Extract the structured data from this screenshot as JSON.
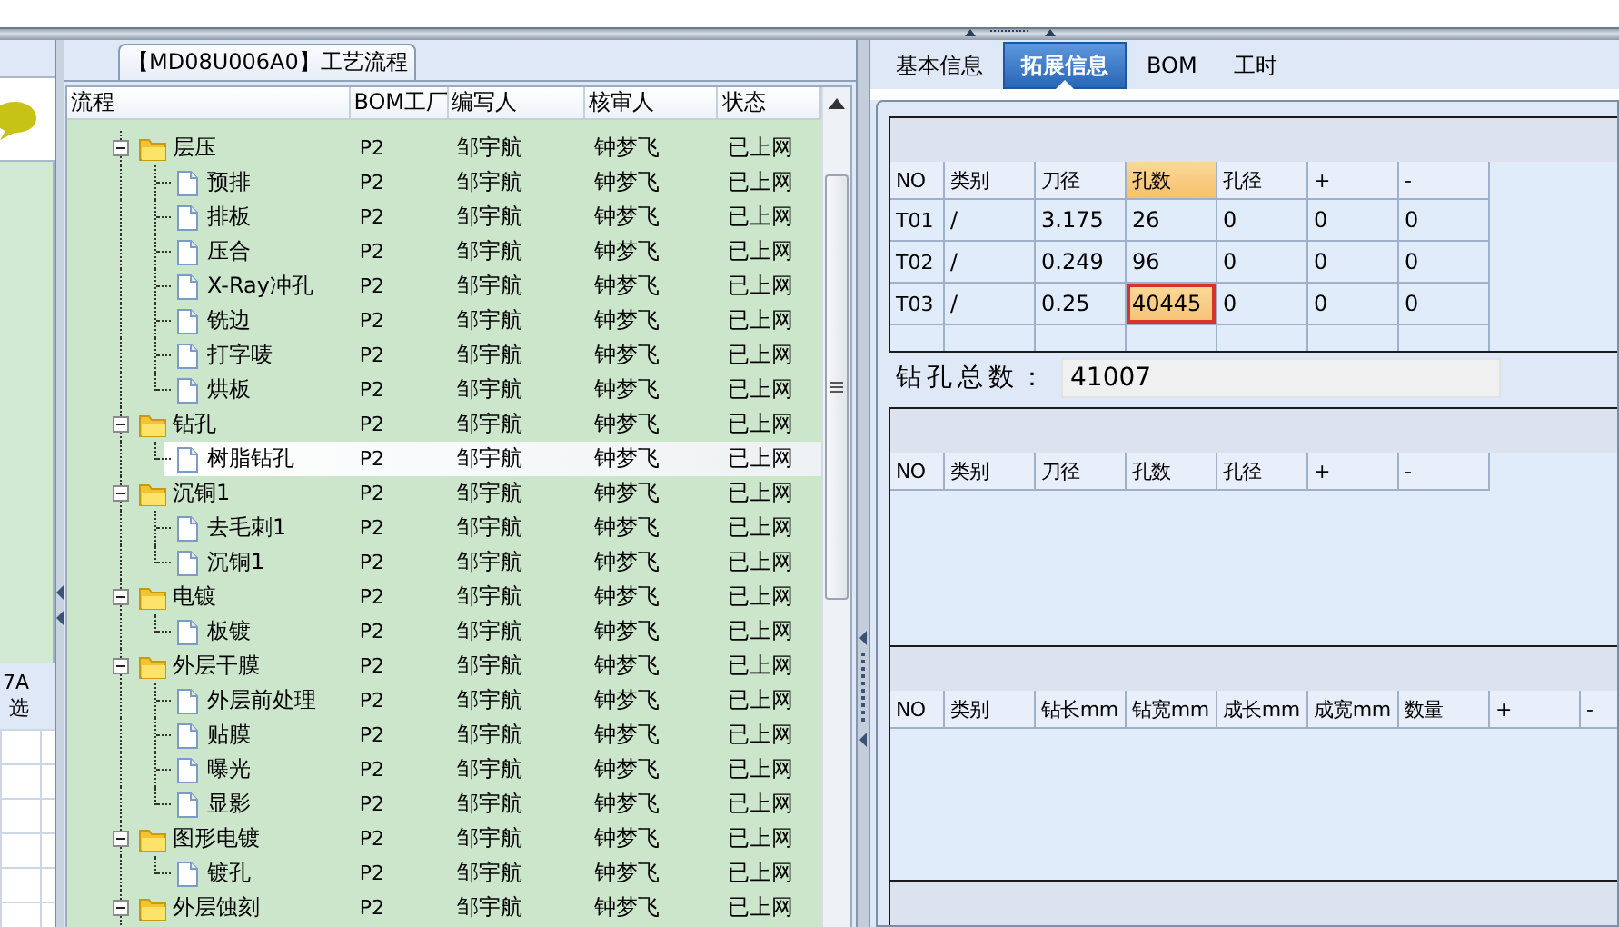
{
  "left_panel": {
    "labels": [
      "7A",
      "选"
    ]
  },
  "tree": {
    "title": "【MD08U006A0】工艺流程",
    "columns": [
      "流程",
      "BOM工厂",
      "编写人",
      "核审人",
      "状态"
    ],
    "nodes": [
      {
        "kind": "folder",
        "label": "层压",
        "plant": "P2",
        "author": "邹宇航",
        "reviewer": "钟梦飞",
        "status": "已上网",
        "expanded": true,
        "selected": false,
        "children": [
          {
            "kind": "file",
            "label": "预排",
            "plant": "P2",
            "author": "邹宇航",
            "reviewer": "钟梦飞",
            "status": "已上网",
            "selected": false
          },
          {
            "kind": "file",
            "label": "排板",
            "plant": "P2",
            "author": "邹宇航",
            "reviewer": "钟梦飞",
            "status": "已上网",
            "selected": false
          },
          {
            "kind": "file",
            "label": "压合",
            "plant": "P2",
            "author": "邹宇航",
            "reviewer": "钟梦飞",
            "status": "已上网",
            "selected": false
          },
          {
            "kind": "file",
            "label": "X-Ray冲孔",
            "plant": "P2",
            "author": "邹宇航",
            "reviewer": "钟梦飞",
            "status": "已上网",
            "selected": false
          },
          {
            "kind": "file",
            "label": "铣边",
            "plant": "P2",
            "author": "邹宇航",
            "reviewer": "钟梦飞",
            "status": "已上网",
            "selected": false
          },
          {
            "kind": "file",
            "label": "打字唛",
            "plant": "P2",
            "author": "邹宇航",
            "reviewer": "钟梦飞",
            "status": "已上网",
            "selected": false
          },
          {
            "kind": "file",
            "label": "烘板",
            "plant": "P2",
            "author": "邹宇航",
            "reviewer": "钟梦飞",
            "status": "已上网",
            "selected": false
          }
        ]
      },
      {
        "kind": "folder",
        "label": "钻孔",
        "plant": "P2",
        "author": "邹宇航",
        "reviewer": "钟梦飞",
        "status": "已上网",
        "expanded": true,
        "selected": false,
        "children": [
          {
            "kind": "file",
            "label": "树脂钻孔",
            "plant": "P2",
            "author": "邹宇航",
            "reviewer": "钟梦飞",
            "status": "已上网",
            "selected": true
          }
        ]
      },
      {
        "kind": "folder",
        "label": "沉铜1",
        "plant": "P2",
        "author": "邹宇航",
        "reviewer": "钟梦飞",
        "status": "已上网",
        "expanded": true,
        "selected": false,
        "children": [
          {
            "kind": "file",
            "label": "去毛刺1",
            "plant": "P2",
            "author": "邹宇航",
            "reviewer": "钟梦飞",
            "status": "已上网",
            "selected": false
          },
          {
            "kind": "file",
            "label": "沉铜1",
            "plant": "P2",
            "author": "邹宇航",
            "reviewer": "钟梦飞",
            "status": "已上网",
            "selected": false
          }
        ]
      },
      {
        "kind": "folder",
        "label": "电镀",
        "plant": "P2",
        "author": "邹宇航",
        "reviewer": "钟梦飞",
        "status": "已上网",
        "expanded": true,
        "selected": false,
        "children": [
          {
            "kind": "file",
            "label": "板镀",
            "plant": "P2",
            "author": "邹宇航",
            "reviewer": "钟梦飞",
            "status": "已上网",
            "selected": false
          }
        ]
      },
      {
        "kind": "folder",
        "label": "外层干膜",
        "plant": "P2",
        "author": "邹宇航",
        "reviewer": "钟梦飞",
        "status": "已上网",
        "expanded": true,
        "selected": false,
        "children": [
          {
            "kind": "file",
            "label": "外层前处理",
            "plant": "P2",
            "author": "邹宇航",
            "reviewer": "钟梦飞",
            "status": "已上网",
            "selected": false
          },
          {
            "kind": "file",
            "label": "贴膜",
            "plant": "P2",
            "author": "邹宇航",
            "reviewer": "钟梦飞",
            "status": "已上网",
            "selected": false
          },
          {
            "kind": "file",
            "label": "曝光",
            "plant": "P2",
            "author": "邹宇航",
            "reviewer": "钟梦飞",
            "status": "已上网",
            "selected": false
          },
          {
            "kind": "file",
            "label": "显影",
            "plant": "P2",
            "author": "邹宇航",
            "reviewer": "钟梦飞",
            "status": "已上网",
            "selected": false
          }
        ]
      },
      {
        "kind": "folder",
        "label": "图形电镀",
        "plant": "P2",
        "author": "邹宇航",
        "reviewer": "钟梦飞",
        "status": "已上网",
        "expanded": true,
        "selected": false,
        "children": [
          {
            "kind": "file",
            "label": "镀孔",
            "plant": "P2",
            "author": "邹宇航",
            "reviewer": "钟梦飞",
            "status": "已上网",
            "selected": false
          }
        ]
      },
      {
        "kind": "folder",
        "label": "外层蚀刻",
        "plant": "P2",
        "author": "邹宇航",
        "reviewer": "钟梦飞",
        "status": "已上网",
        "expanded": true,
        "selected": false
      }
    ]
  },
  "tabs": [
    {
      "label": "基本信息",
      "selected": false
    },
    {
      "label": "拓展信息",
      "selected": true
    },
    {
      "label": "BOM",
      "selected": false
    },
    {
      "label": "工时",
      "selected": false
    }
  ],
  "drill_grid": {
    "columns": [
      {
        "label": "NO",
        "selected": false
      },
      {
        "label": "类别",
        "selected": false
      },
      {
        "label": "刀径",
        "selected": false
      },
      {
        "label": "孔数",
        "selected": true
      },
      {
        "label": "孔径",
        "selected": false
      },
      {
        "label": "+",
        "selected": false
      },
      {
        "label": "-",
        "selected": false
      }
    ],
    "rows": [
      {
        "cells": [
          {
            "text": "T01",
            "selected": false
          },
          {
            "text": "/",
            "selected": false
          },
          {
            "text": "3.175",
            "selected": false
          },
          {
            "text": "26",
            "selected": false
          },
          {
            "text": "0",
            "selected": false
          },
          {
            "text": "0",
            "selected": false
          },
          {
            "text": "0",
            "selected": false
          }
        ]
      },
      {
        "cells": [
          {
            "text": "T02",
            "selected": false
          },
          {
            "text": "/",
            "selected": false
          },
          {
            "text": "0.249",
            "selected": false
          },
          {
            "text": "96",
            "selected": false
          },
          {
            "text": "0",
            "selected": false
          },
          {
            "text": "0",
            "selected": false
          },
          {
            "text": "0",
            "selected": false
          }
        ]
      },
      {
        "cells": [
          {
            "text": "T03",
            "selected": false
          },
          {
            "text": "/",
            "selected": false
          },
          {
            "text": "0.25",
            "selected": false
          },
          {
            "text": "40445",
            "selected": true
          },
          {
            "text": "0",
            "selected": false
          },
          {
            "text": "0",
            "selected": false
          },
          {
            "text": "0",
            "selected": false
          }
        ]
      }
    ]
  },
  "drill_total": {
    "label": "钻孔总数：",
    "value": "41007"
  },
  "grid_2": {
    "columns": [
      {
        "label": "NO",
        "selected": false
      },
      {
        "label": "类别",
        "selected": false
      },
      {
        "label": "刀径",
        "selected": false
      },
      {
        "label": "孔数",
        "selected": false
      },
      {
        "label": "孔径",
        "selected": false
      },
      {
        "label": "+",
        "selected": false
      },
      {
        "label": "-",
        "selected": false
      }
    ]
  },
  "grid_3": {
    "columns": [
      {
        "label": "NO",
        "selected": false
      },
      {
        "label": "类别",
        "selected": false
      },
      {
        "label": "钻长mm",
        "selected": false
      },
      {
        "label": "钻宽mm",
        "selected": false
      },
      {
        "label": "成长mm",
        "selected": false
      },
      {
        "label": "成宽mm",
        "selected": false
      },
      {
        "label": "数量",
        "selected": false
      },
      {
        "label": "+",
        "selected": false
      },
      {
        "label": "-",
        "selected": false
      }
    ]
  }
}
